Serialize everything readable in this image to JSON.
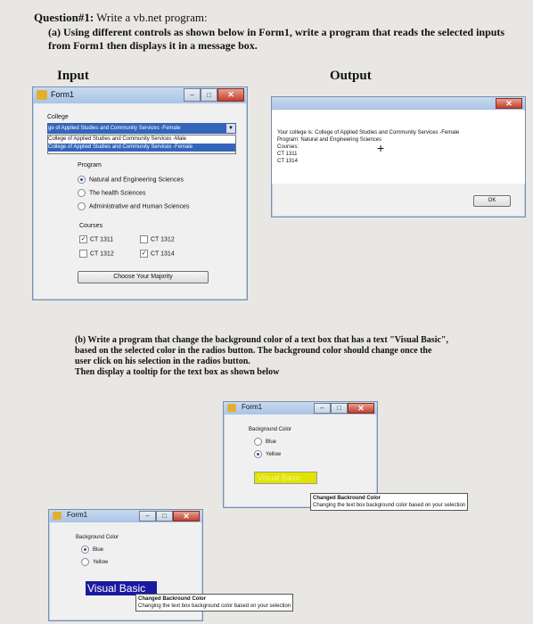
{
  "question": {
    "title_bold": "Question#1:",
    "title_rest": " Write a vb.net program:",
    "part_a": "(a) Using different controls as shown below in Form1, write a program that reads the selected inputs from Form1 then displays it in a message box.",
    "input_header": "Input",
    "output_header": "Output",
    "part_b_lines": [
      "(b) Write a program that change the background color of a text box that has a text \"Visual Basic\",",
      "based on the selected color in the radios button. The background color should change once the",
      "user click on his selection in the radios button.",
      "Then display a tooltip for the text box as shown below"
    ]
  },
  "form1": {
    "title": "Form1",
    "college_label": "College",
    "college_selected": "ge of Applied Studies and Community Services -Female",
    "college_items": [
      "College of Applied Studies and Community Services -Male",
      "College of Applied Studies and Community Services -Female"
    ],
    "program_label": "Program",
    "programs": [
      {
        "label": "Natural and Engineering Sciences",
        "checked": true
      },
      {
        "label": "The health Sciences",
        "checked": false
      },
      {
        "label": "Administrative and Human Sciences",
        "checked": false
      }
    ],
    "courses_label": "Courses",
    "courses": [
      {
        "label": "CT 1311",
        "checked": true
      },
      {
        "label": "CT 1312",
        "checked": false
      },
      {
        "label": "CT 1312",
        "checked": false
      },
      {
        "label": "CT 1314",
        "checked": true
      }
    ],
    "button": "Choose Your Majority"
  },
  "output": {
    "line1": "Your college is: College of Applied Studies and Community Services -Female",
    "line2": "Program: Natural and Engineering Sciences",
    "line3": "Courses:",
    "line4": "CT 1311",
    "line5": "CT 1314",
    "ok": "OK"
  },
  "form_b1": {
    "title": "Form1",
    "group_label": "Background Color",
    "opt1": "Blue",
    "opt2": "Yellow",
    "textbox": "Visual Basic",
    "tip_title": "Changed Backround Color",
    "tip_text": "Changing the text box background color based on your selection",
    "textbox_color": "#e2e200"
  },
  "form_b2": {
    "title": "Form1",
    "group_label": "Background Color",
    "opt1": "Blue",
    "opt2": "Yellow",
    "textbox": "Visual Basic",
    "tip_title": "Changed Backround Color",
    "tip_text": "Changing the text box background color based on your selection",
    "textbox_color": "#1a1aa0"
  }
}
